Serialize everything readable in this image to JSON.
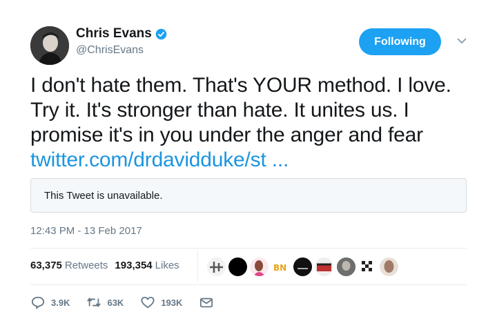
{
  "user": {
    "name": "Chris Evans",
    "handle": "@ChrisEvans",
    "verified": true
  },
  "follow_button": {
    "label": "Following"
  },
  "tweet": {
    "text": "I don't hate them. That's YOUR method. I love. Try it. It's stronger than hate. It unites us. I promise it's in you under the anger and fear ",
    "link": "twitter.com/drdavidduke/st ...",
    "quoted_notice": "This Tweet is unavailable.",
    "timestamp": "12:43 PM - 13 Feb 2017"
  },
  "stats": {
    "retweets_count": "63,375",
    "retweets_label": "Retweets",
    "likes_count": "193,354",
    "likes_label": "Likes"
  },
  "actions": {
    "replies": "3.9K",
    "retweets": "63K",
    "likes": "193K"
  },
  "colors": {
    "accent": "#1da1f2",
    "link": "#1b95e0",
    "muted": "#657786"
  }
}
